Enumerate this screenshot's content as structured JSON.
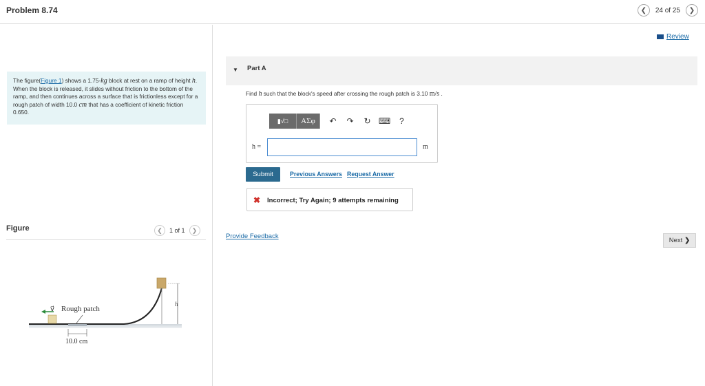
{
  "header": {
    "title": "Problem 8.74",
    "page_counter": "24 of 25",
    "prev_icon": "chevron-left-icon",
    "next_icon": "chevron-right-icon"
  },
  "review": {
    "label": "Review",
    "icon": "book-icon"
  },
  "intro": {
    "text_before_link": "The figure(",
    "link": "Figure 1",
    "text_1": ") shows a 1.75-",
    "unit_kg": "kg",
    "text_2": " block at rest on a ramp of height ",
    "var_h": "h",
    "text_3": ". When the block is released, it slides without friction to the bottom of the ramp, and then continues across a surface that is frictionless except for a rough patch of width 10.0 ",
    "unit_cm": "cm",
    "text_4": " that has a coefficient of kinetic friction 0.650.",
    "bg_color": "#e6f4f6"
  },
  "figure": {
    "label": "Figure",
    "counter": "1 of 1",
    "labels": {
      "velocity": "v⃗",
      "rough_patch": "Rough patch",
      "height": "h",
      "width": "10.0 cm"
    }
  },
  "part_a": {
    "label": "Part A",
    "question_before": "Find ",
    "question_var": "h",
    "question_mid": " such that the block's speed after crossing the rough patch is 3.10 ",
    "question_unit": "m/s",
    "question_end": " .",
    "toolbar": {
      "templates": "▮√□",
      "greek": "ΑΣφ",
      "undo_icon": "undo-icon",
      "redo_icon": "redo-icon",
      "reset_icon": "reset-icon",
      "keyboard_icon": "keyboard-icon",
      "help": "?"
    },
    "input_label": "h =",
    "input_value": "",
    "unit": "m",
    "submit": "Submit",
    "previous_answers": "Previous Answers",
    "request_answer": "Request Answer",
    "feedback": "Incorrect; Try Again; 9 attempts remaining"
  },
  "footer": {
    "provide_feedback": "Provide Feedback",
    "next": "Next"
  },
  "colors": {
    "link": "#1a6aa6",
    "submit_bg": "#2b6a8f",
    "error": "#d0302a"
  }
}
